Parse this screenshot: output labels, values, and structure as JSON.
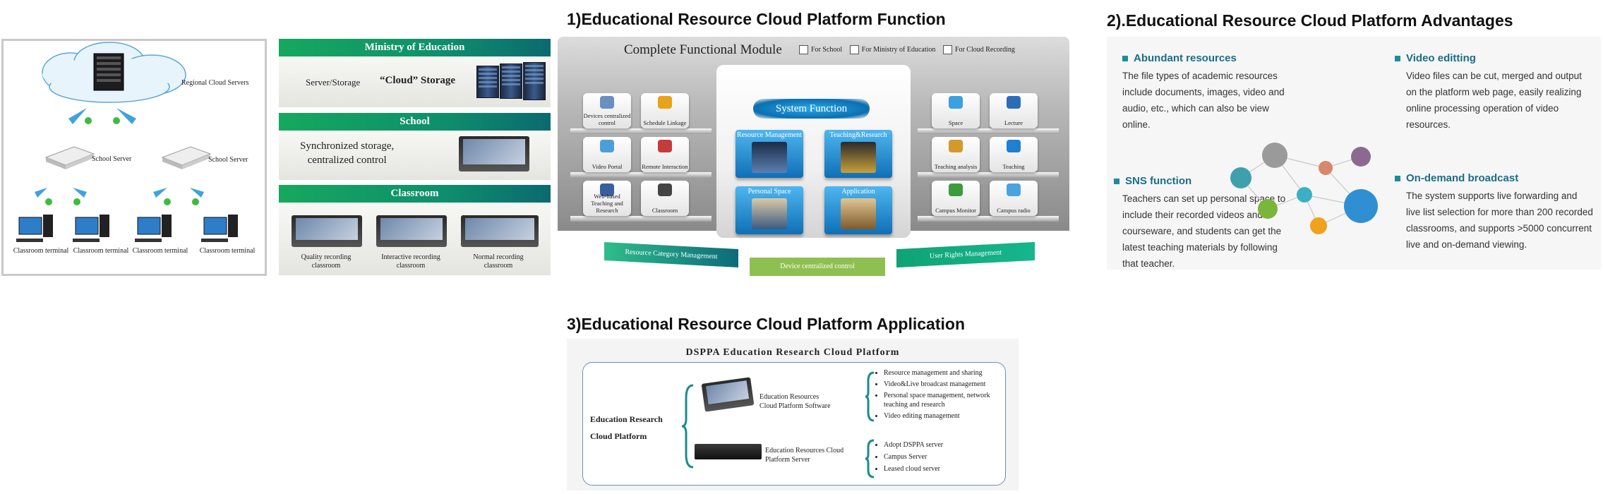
{
  "sections": {
    "function_title": "1)Educational Resource Cloud Platform Function",
    "advantages_title": "2).Educational Resource Cloud Platform Advantages",
    "application_title": "3)Educational Resource Cloud Platform Application"
  },
  "network": {
    "regional": "Regional Cloud Servers",
    "school_server_1": "School Server",
    "school_server_2": "School Server",
    "terminals": [
      "Classroom terminal",
      "Classroom terminal",
      "Classroom terminal",
      "Classroom terminal"
    ]
  },
  "hierarchy": {
    "ministry_bar": "Ministry of Education",
    "ministry_text1": "Server/Storage",
    "ministry_text2": "“Cloud” Storage",
    "school_bar": "School",
    "school_text": "Synchronized storage,\ncentralized control",
    "classroom_bar": "Classroom",
    "classrooms": [
      "Quality recording classroom",
      "Interactive recording classroom",
      "Normal recording classroom"
    ]
  },
  "function_module": {
    "title": "Complete Functional Module",
    "checks": [
      "For School",
      "For Ministry of Education",
      "For Cloud Recording"
    ],
    "left_tiles": [
      "Devices centralized control",
      "Schedule Linkage",
      "Video Portal",
      "Remote Interaction",
      "Web-based Teaching and Research",
      "Classroom"
    ],
    "right_tiles": [
      "Space",
      "Lecture",
      "Teaching analysis",
      "Teaching",
      "Campus Monitor",
      "Campus radio"
    ],
    "system_function": "System Function",
    "center_boxes": [
      "Resource Management",
      "Teaching&Research",
      "Personal Space",
      "Application"
    ],
    "footer": [
      "Resource Category Management",
      "Device centralized control",
      "User Rights Management"
    ]
  },
  "advantages": {
    "items": [
      {
        "heading": "Abundant resources",
        "text": "The file types of academic resources include documents, images, video and audio, etc., which can also be view online."
      },
      {
        "heading": "Video editting",
        "text": "Video files can be cut, merged and output on the platform web page, easily realizing online processing operation of video resources."
      },
      {
        "heading": "SNS function",
        "text": "Teachers can set up personal space to include their recorded videos and courseware, and students can get the latest teaching materials by following that teacher."
      },
      {
        "heading": "On-demand broadcast",
        "text": "The system supports live forwarding and live list selection for more than 200 recorded classrooms, and supports >5000 concurrent live and on-demand viewing."
      }
    ],
    "accent": "#1b8c99"
  },
  "application": {
    "title": "DSPPA Education Research Cloud Platform",
    "root_line1": "Education Research",
    "root_line2": "Cloud Platform",
    "software": "Education Resources Cloud Platform Software",
    "server": "Education Resources Cloud Platform Server",
    "software_items": [
      "Resource management and sharing",
      "Video&Live broadcast management",
      "Personal space management, network teaching and research",
      "Video editing management"
    ],
    "server_items": [
      "Adopt DSPPA server",
      "Campus Server",
      "Leased cloud server"
    ]
  }
}
